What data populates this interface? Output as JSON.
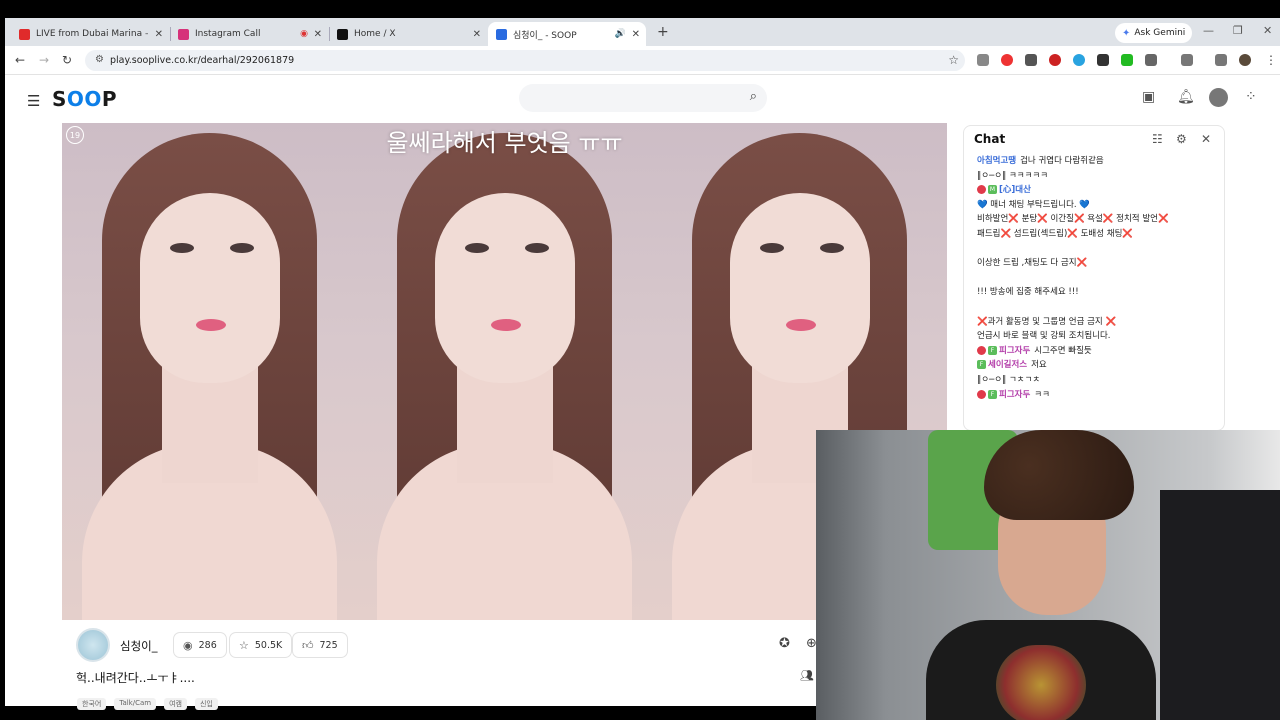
{
  "browser": {
    "tabs": [
      {
        "label": "LIVE from Dubai Marina – Tensi",
        "icon_color": "#e02b2b",
        "icon": "youtube-icon"
      },
      {
        "label": "Instagram Call",
        "icon_color": "#d6327a",
        "icon": "instagram-icon"
      },
      {
        "label": "Home / X",
        "icon_color": "#111111",
        "icon": "x-icon"
      },
      {
        "label": "심청이_ - SOOP",
        "icon_color": "#2a6be0",
        "icon": "soop-icon"
      }
    ],
    "ask_gemini": "Ask Gemini",
    "url": "play.sooplive.co.kr/dearhal/292061879"
  },
  "site": {
    "logo_prefix": "S",
    "logo_oo": "OO",
    "logo_suffix": "P",
    "search_placeholder": ""
  },
  "video": {
    "age_badge": "19",
    "caption": "울쎄라해서 부엇음 ㅠㅠ"
  },
  "chat": {
    "title": "Chat",
    "lines": [
      {
        "nick": "아침먹고땡",
        "text": "겁나 귀엽다 다람쥐같음",
        "nick_color": "blue"
      },
      {
        "nick": "",
        "text": "‖ㅇ─ㅇ‖  ㅋㅋㅋㅋㅋ"
      },
      {
        "nick": "[心]대산",
        "text": "",
        "nick_color": "blue",
        "badges": true
      },
      {
        "nick": "",
        "text": "💙 매너 채팅 부탁드립니다. 💙"
      },
      {
        "nick": "",
        "text": "비하발언❌ 분탕❌ 이간질❌ 욕설❌ 정치적 발언❌"
      },
      {
        "nick": "",
        "text": "패드립❌ 섬드립(섹드립)❌ 도배성 채팅❌"
      },
      {
        "gap": true
      },
      {
        "nick": "",
        "text": "이상한 드립 ,채팅도 다 금지❌"
      },
      {
        "gap": true
      },
      {
        "nick": "",
        "text": "!!! 방송에 집중 해주세요 !!!"
      },
      {
        "gap": true
      },
      {
        "nick": "",
        "text": "❌과거 활동명 및 그룹명 언급 금지 ❌"
      },
      {
        "nick": "",
        "text": "언급시 바로 블랙 및 강퇴 조치됩니다."
      },
      {
        "nick": "피그자두",
        "text": "시그주면 빠질듯",
        "nick_color": "purple",
        "badges": true
      },
      {
        "nick": "세이길저스",
        "text": "저요",
        "nick_color": "purple",
        "badges": true
      },
      {
        "nick": "",
        "text": "‖ㅇ─ㅇ‖  ㄱㅊㄱㅊ"
      },
      {
        "nick": "피그자두",
        "text": "ㅋㅋ",
        "nick_color": "purple",
        "badges": true
      }
    ]
  },
  "stream": {
    "streamer": "심청이_",
    "viewers": "286",
    "favorites": "50.5K",
    "likes": "725",
    "title": "헉..내려간다..ㅗㅜㅑ....",
    "tags": [
      "한국어",
      "Talk/Cam",
      "여캠",
      "신입"
    ]
  }
}
